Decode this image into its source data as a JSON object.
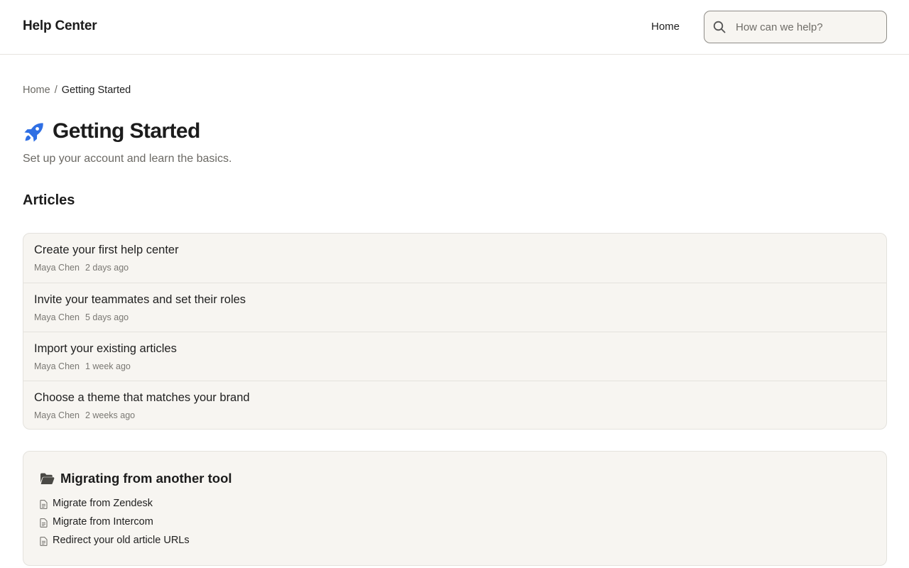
{
  "header": {
    "brand": "Help Center",
    "nav_home": "Home",
    "search_placeholder": "How can we help?"
  },
  "breadcrumb": {
    "home": "Home",
    "separator": "/",
    "current": "Getting Started"
  },
  "page": {
    "icon": "rocket-icon",
    "title": "Getting Started",
    "subtitle": "Set up your account and learn the basics."
  },
  "articles_section": {
    "heading": "Articles",
    "items": [
      {
        "title": "Create your first help center",
        "author": "Maya Chen",
        "date": "2 days ago"
      },
      {
        "title": "Invite your teammates and set their roles",
        "author": "Maya Chen",
        "date": "5 days ago"
      },
      {
        "title": "Import your existing articles",
        "author": "Maya Chen",
        "date": "1 week ago"
      },
      {
        "title": "Choose a theme that matches your brand",
        "author": "Maya Chen",
        "date": "2 weeks ago"
      }
    ]
  },
  "subcategory": {
    "icon": "folder-open-icon",
    "title": "Migrating from another tool",
    "links": [
      {
        "icon": "document-icon",
        "label": "Migrate from Zendesk"
      },
      {
        "icon": "document-icon",
        "label": "Migrate from Intercom"
      },
      {
        "icon": "document-icon",
        "label": "Redirect your old article URLs"
      }
    ]
  },
  "colors": {
    "accent": "#2f6fe4",
    "text": "#1f1f1f",
    "muted": "#6b6964",
    "card_background": "#f7f5f1",
    "border": "#e4e2dd"
  }
}
